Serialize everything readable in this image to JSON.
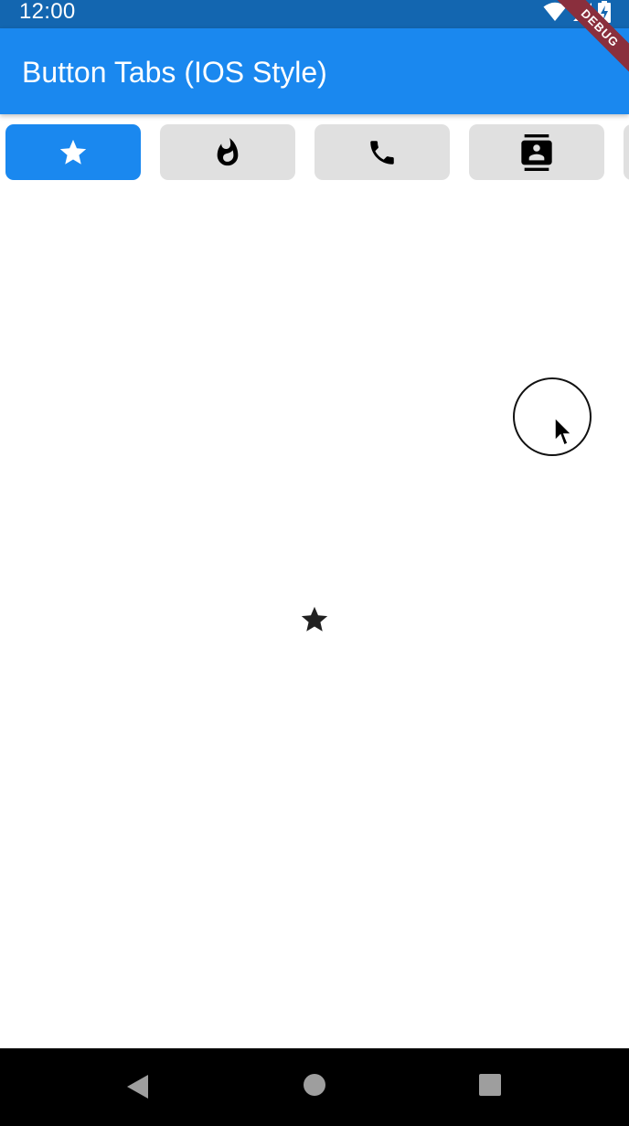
{
  "status_bar": {
    "time": "12:00",
    "icons": [
      "wifi-icon",
      "signal-icon",
      "battery-charging-icon"
    ]
  },
  "app_bar": {
    "title": "Button Tabs (IOS Style)",
    "debug_banner": "DEBUG"
  },
  "tabs": [
    {
      "icon": "star-icon",
      "selected": true
    },
    {
      "icon": "whatshot-icon",
      "selected": false
    },
    {
      "icon": "phone-icon",
      "selected": false
    },
    {
      "icon": "contacts-icon",
      "selected": false
    },
    {
      "icon": "partial-tab",
      "selected": false
    }
  ],
  "content": {
    "icon": "star-icon"
  },
  "nav_bar": {
    "buttons": [
      "back-icon",
      "home-icon",
      "recents-icon"
    ]
  },
  "colors": {
    "status_bar": "#1366b0",
    "app_bar": "#1a88ef",
    "tab_active": "#1a88ef",
    "tab_inactive": "#e0e0e0",
    "nav_bar": "#000000"
  }
}
